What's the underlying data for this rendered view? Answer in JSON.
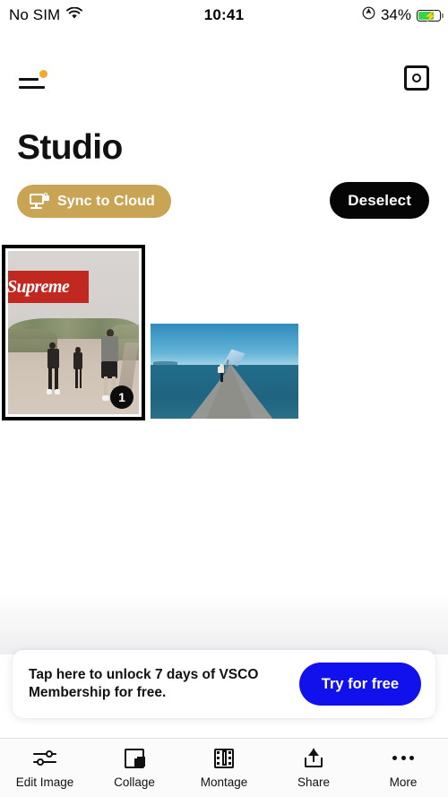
{
  "status_bar": {
    "carrier": "No SIM",
    "wifi_icon": "wifi-icon",
    "time": "10:41",
    "location_icon": "location-arrow-icon",
    "battery_percent": "34%",
    "battery_charging": true
  },
  "top_nav": {
    "menu_icon": "hamburger-menu-icon",
    "menu_badge": true,
    "menu_badge_color": "#f0a92b",
    "camera_icon": "camera-icon"
  },
  "header": {
    "title": "Studio"
  },
  "actions": {
    "sync": {
      "label": "Sync to Cloud",
      "icon": "monitor-lock-icon",
      "bg_color": "#c9a455"
    },
    "deselect": {
      "label": "Deselect",
      "bg_color": "#050505"
    }
  },
  "gallery": {
    "items": [
      {
        "name": "supreme-photo",
        "selected": true,
        "badge": "1",
        "overlay_text": "Supreme",
        "overlay_color": "#c1281f"
      },
      {
        "name": "pier-photo",
        "selected": false,
        "badge": "",
        "overlay_text": "",
        "overlay_color": ""
      }
    ]
  },
  "promo": {
    "text": "Tap here to unlock 7 days of VSCO Membership for free.",
    "cta_label": "Try for free",
    "cta_color": "#1111ee"
  },
  "toolbar": {
    "items": [
      {
        "label": "Edit Image",
        "icon": "sliders-icon"
      },
      {
        "label": "Collage",
        "icon": "collage-grid-icon"
      },
      {
        "label": "Montage",
        "icon": "film-strip-icon"
      },
      {
        "label": "Share",
        "icon": "share-upload-icon"
      },
      {
        "label": "More",
        "icon": "ellipsis-icon"
      }
    ]
  }
}
